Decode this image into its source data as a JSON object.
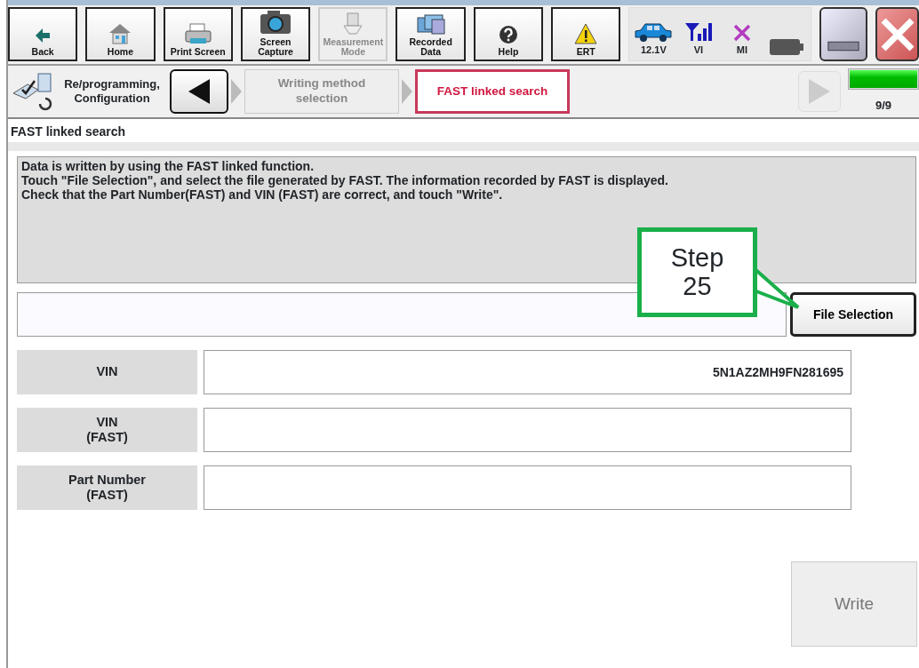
{
  "toolbar": {
    "buttons": [
      {
        "kind": "back",
        "label": "Back",
        "disabled": false
      },
      {
        "kind": "home",
        "label": "Home",
        "disabled": false
      },
      {
        "kind": "printer",
        "label": "Print Screen",
        "disabled": false
      },
      {
        "kind": "camera",
        "label": "Screen\nCapture",
        "disabled": false
      },
      {
        "kind": "meter",
        "label": "Measurement\nMode",
        "disabled": true
      },
      {
        "kind": "folders",
        "label": "Recorded\nData",
        "disabled": false
      },
      {
        "kind": "help",
        "label": "Help",
        "disabled": false
      },
      {
        "kind": "warning",
        "label": "ERT",
        "disabled": false
      }
    ],
    "status": [
      {
        "kind": "car",
        "label": "12.1V"
      },
      {
        "kind": "signal",
        "label": "VI"
      },
      {
        "kind": "cross",
        "label": "MI"
      },
      {
        "kind": "battery"
      }
    ]
  },
  "breadcrumb": {
    "title": "Re/programming,\nConfiguration",
    "back_disabled": false,
    "next_disabled": true,
    "steps": [
      {
        "label": "Writing method\nselection",
        "selected": false
      },
      {
        "label": "FAST linked search",
        "selected": true
      }
    ],
    "progress": {
      "level": 1.0,
      "reading": "9/9"
    }
  },
  "section_title": "FAST linked search",
  "instructions": [
    "Data is written by using the FAST linked function.",
    "Touch \"File Selection\", and select the file generated by FAST. The information recorded by FAST is displayed.",
    "Check that the Part Number(FAST) and VIN (FAST) are correct, and touch \"Write\"."
  ],
  "file_selection": {
    "button": "File Selection"
  },
  "callout": {
    "text": "Step\n25"
  },
  "fields": [
    {
      "label": "VIN",
      "value": "5N1AZ2MH9FN281695"
    },
    {
      "label": "VIN\n(FAST)"
    },
    {
      "label": "Part Number\n(FAST)"
    }
  ],
  "write_button": {
    "label": "Write",
    "disabled": true
  }
}
